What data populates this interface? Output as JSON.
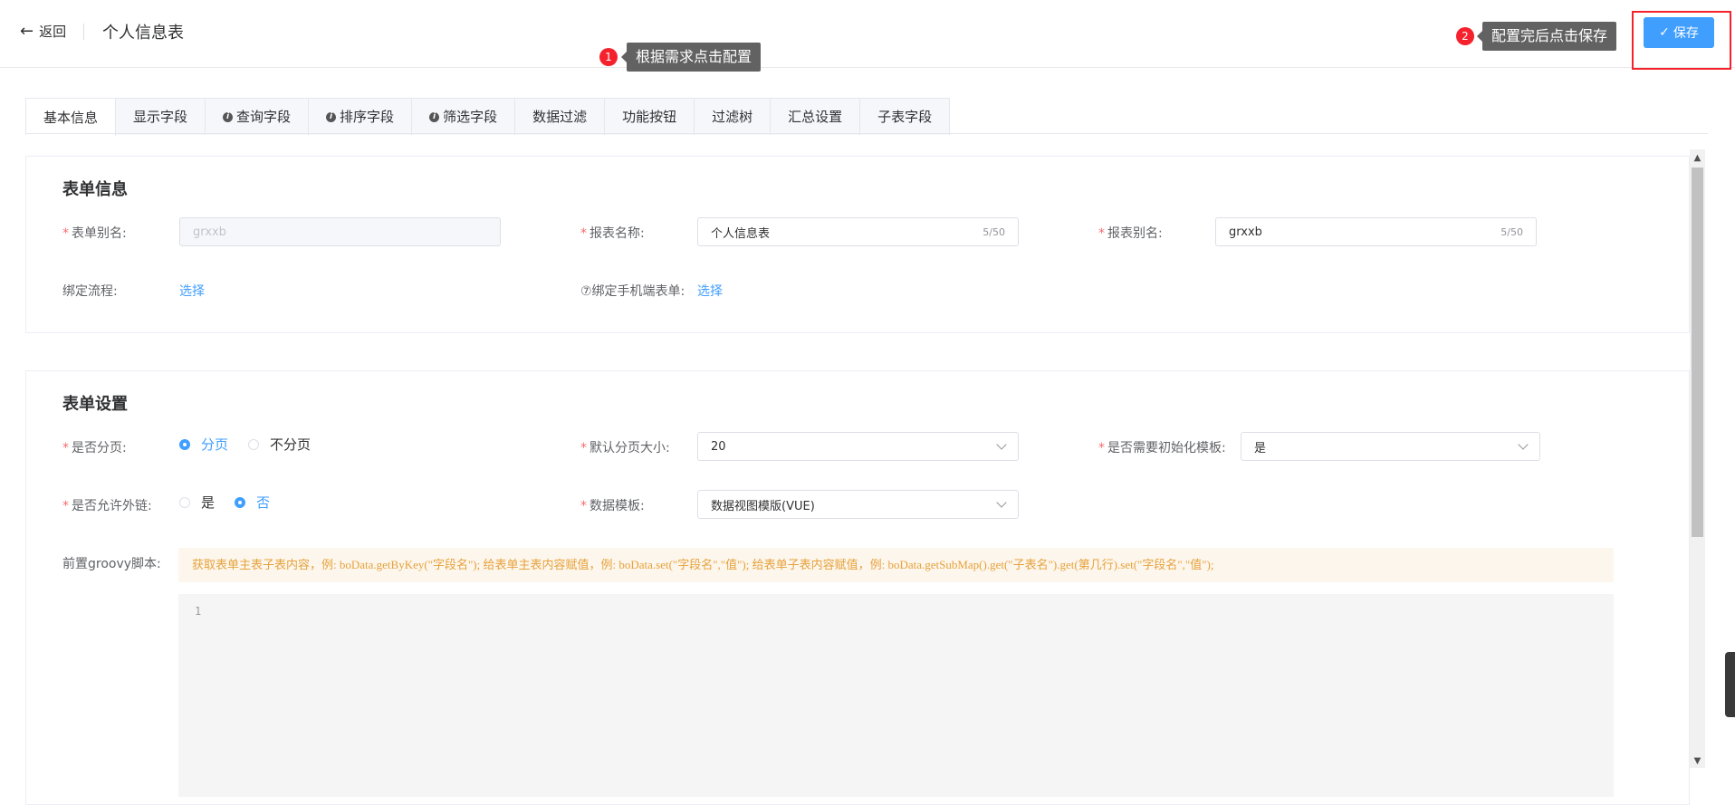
{
  "header": {
    "back_label": "返回",
    "page_title": "个人信息表",
    "annotation1": {
      "number": "1",
      "text": "根据需求点击配置"
    },
    "annotation2": {
      "number": "2",
      "text": "配置完后点击保存"
    },
    "save_label": "保存"
  },
  "tabs": [
    {
      "label": "基本信息",
      "active": true,
      "info": false
    },
    {
      "label": "显示字段",
      "active": false,
      "info": false
    },
    {
      "label": "查询字段",
      "active": false,
      "info": true
    },
    {
      "label": "排序字段",
      "active": false,
      "info": true
    },
    {
      "label": "筛选字段",
      "active": false,
      "info": true
    },
    {
      "label": "数据过滤",
      "active": false,
      "info": false
    },
    {
      "label": "功能按钮",
      "active": false,
      "info": false
    },
    {
      "label": "过滤树",
      "active": false,
      "info": false
    },
    {
      "label": "汇总设置",
      "active": false,
      "info": false
    },
    {
      "label": "子表字段",
      "active": false,
      "info": false
    }
  ],
  "form_info": {
    "title": "表单信息",
    "form_alias_label": "表单别名:",
    "form_alias_value": "grxxb",
    "report_name_label": "报表名称:",
    "report_name_value": "个人信息表",
    "report_name_count": "5/50",
    "report_alias_label": "报表别名:",
    "report_alias_value": "grxxb",
    "report_alias_count": "5/50",
    "bind_flow_label": "绑定流程:",
    "bind_flow_link": "选择",
    "bind_mobile_label": "⑦绑定手机端表单:",
    "bind_mobile_link": "选择"
  },
  "form_settings": {
    "title": "表单设置",
    "paging_label": "是否分页:",
    "paging_options": [
      "分页",
      "不分页"
    ],
    "paging_selected": "分页",
    "page_size_label": "默认分页大小:",
    "page_size_value": "20",
    "init_template_label": "是否需要初始化模板:",
    "init_template_value": "是",
    "external_link_label": "是否允许外链:",
    "external_link_options": [
      "是",
      "否"
    ],
    "external_link_selected": "否",
    "data_template_label": "数据模板:",
    "data_template_value": "数据视图模版(VUE)",
    "groovy_label": "前置groovy脚本:",
    "groovy_hint": "获取表单主表子表内容，例: boData.getByKey(\"字段名\"); 给表单主表内容赋值，例: boData.set(\"字段名\",\"值\"); 给表单子表内容赋值，例: boData.getSubMap().get(\"子表名\").get(第几行).set(\"字段名\",\"值\");",
    "editor_line_number": "1"
  },
  "colors": {
    "primary": "#409eff",
    "required": "#f56c6c",
    "annotation_red": "#f5222d",
    "hint_bg": "#fdf6ec",
    "hint_text": "#e6a23c"
  }
}
